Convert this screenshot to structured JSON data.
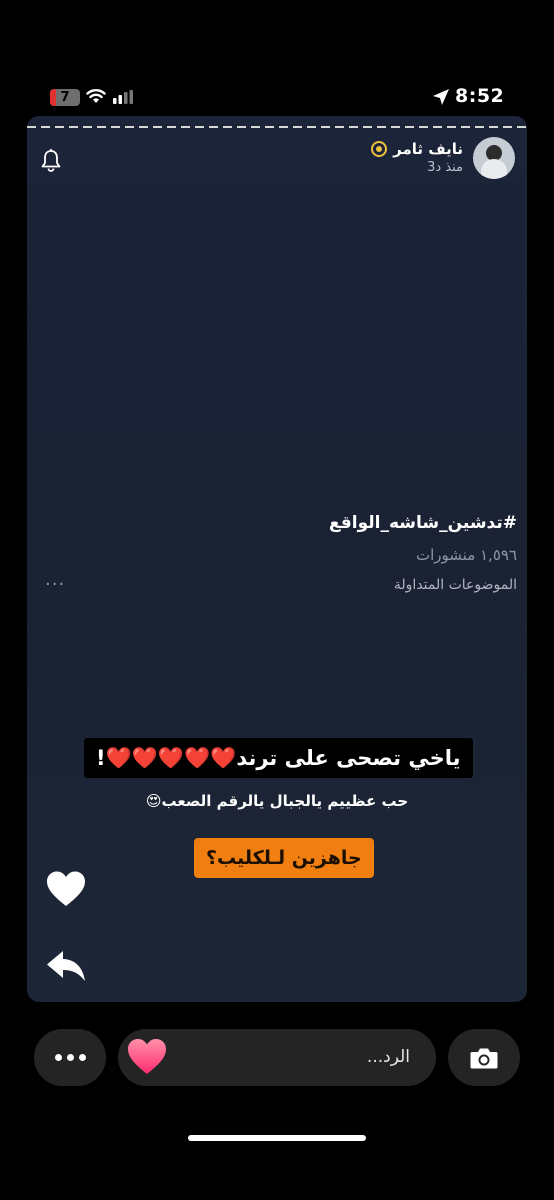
{
  "status_bar": {
    "time": "8:52",
    "battery_level": "7",
    "icons": [
      "battery-icon",
      "wifi-icon",
      "signal-icon",
      "location-arrow-icon"
    ]
  },
  "story": {
    "user_name": "نايف ثامر",
    "posted_time": "منذ د3",
    "trend": {
      "hashtag": "#تدشين_شاشه_الواقع",
      "posts_count": "١,٥٩٦ منشورات",
      "label": "الموضوعات المتداولة",
      "more": "···"
    },
    "captions": {
      "line1": "ياخي تصحى على ترند❤️❤️❤️❤️❤️!",
      "line2": "حب عظييم يالجبال يالرقم الصعب😍",
      "line3": "جاهزين لـلكليب؟"
    },
    "colors": {
      "caption_highlight": "#f07e10",
      "card_background": "#1a2233"
    }
  },
  "reply_bar": {
    "placeholder": "الرد...",
    "quick_reaction": "heart"
  }
}
